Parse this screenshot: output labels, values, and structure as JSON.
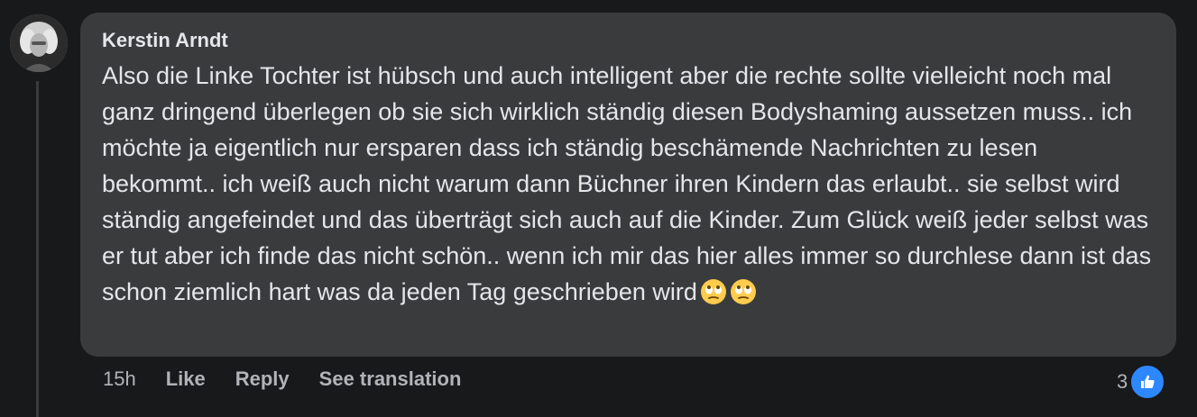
{
  "comment": {
    "author": "Kerstin Arndt",
    "text": "Also die Linke Tochter ist hübsch und auch intelligent aber die rechte sollte vielleicht noch mal ganz dringend überlegen ob sie sich wirklich ständig diesen Bodyshaming aussetzen muss.. ich möchte ja eigentlich nur ersparen dass ich ständig beschämende Nachrichten zu lesen bekommt.. ich weiß auch nicht warum dann Büchner ihren Kindern das erlaubt.. sie selbst wird ständig angefeindet und das überträgt sich auch auf die Kinder. Zum Glück weiß jeder selbst was er tut aber ich finde das nicht schön.. wenn ich mir das hier alles immer so durchlese dann ist das schon ziemlich hart was da jeden Tag geschrieben wird",
    "emojis": [
      "face-with-rolling-eyes",
      "face-with-rolling-eyes"
    ],
    "timestamp": "15h",
    "reaction_count": "3",
    "reaction_icon": "like-icon"
  },
  "actions": {
    "like": "Like",
    "reply": "Reply",
    "see_translation": "See translation"
  },
  "colors": {
    "background": "#18191a",
    "bubble": "#3a3b3c",
    "text": "#e4e6eb",
    "secondary_text": "#b0b3b8",
    "like_blue": "#2d88ff"
  }
}
